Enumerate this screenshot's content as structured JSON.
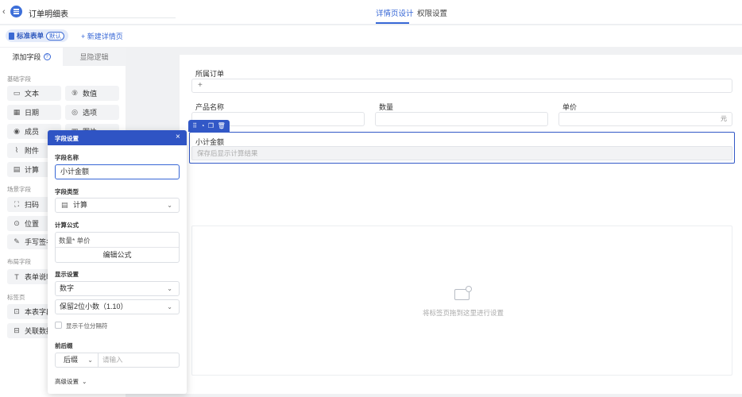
{
  "header": {
    "back_icon": "chevron-left-icon",
    "app_icon": "grid-app-icon",
    "title": "订单明细表",
    "tabs": [
      {
        "label": "详情页设计",
        "active": true
      },
      {
        "label": "权限设置",
        "active": false
      }
    ],
    "accent_color": "#3767d6"
  },
  "subbar": {
    "chip_label": "标准表单",
    "chip_badge": "默认",
    "new_page_label": "+ 新建详情页"
  },
  "left_panel": {
    "tabs": [
      {
        "label": "添加字段",
        "active": true
      },
      {
        "label": "显隐逻辑",
        "active": false
      }
    ],
    "sections": {
      "basic": "基础字段",
      "scene": "场景字段",
      "layout": "布局字段",
      "tab": "标签页"
    },
    "fields": {
      "text": {
        "label": "文本",
        "icon": "text-field-icon"
      },
      "number": {
        "label": "数值",
        "icon": "number-icon"
      },
      "date": {
        "label": "日期",
        "icon": "calendar-icon"
      },
      "option": {
        "label": "选项",
        "icon": "check-circle-icon"
      },
      "member": {
        "label": "成员",
        "icon": "member-icon"
      },
      "image": {
        "label": "图片",
        "icon": "image-icon"
      },
      "attachment": {
        "label": "附件",
        "icon": "paperclip-icon"
      },
      "calc": {
        "label": "计算",
        "icon": "calculator-icon"
      },
      "scan": {
        "label": "扫码",
        "icon": "scan-icon"
      },
      "location": {
        "label": "位置",
        "icon": "location-icon"
      },
      "signature": {
        "label": "手写签名",
        "icon": "signature-icon"
      },
      "form_desc": {
        "label": "表单说明",
        "icon": "text-t-icon"
      },
      "this_table": {
        "label": "本表字段",
        "icon": "table-icon"
      },
      "related": {
        "label": "关联数据",
        "icon": "link-data-icon"
      }
    }
  },
  "canvas": {
    "fields": {
      "order": {
        "label": "所属订单",
        "value": "+"
      },
      "product": {
        "label": "产品名称",
        "value": ""
      },
      "quantity": {
        "label": "数量",
        "value": ""
      },
      "price": {
        "label": "单价",
        "unit": "元"
      },
      "subtotal": {
        "label": "小计金额",
        "placeholder": "保存后显示计算结果"
      }
    },
    "toolbar_icons": [
      "drag-handle-icon",
      "copy-style-icon",
      "duplicate-icon",
      "delete-icon"
    ],
    "drop_zone_text": "将标签页拖到这里进行设置",
    "drop_zone_icon": "folder-add-icon"
  },
  "modal": {
    "title": "字段设置",
    "field_name_label": "字段名称",
    "field_name_value": "小计金额",
    "field_type_label": "字段类型",
    "field_type_value": "计算",
    "formula_label": "计算公式",
    "formula_value": "数量* 单价",
    "formula_button": "编辑公式",
    "display_label": "显示设置",
    "display_format": "数字",
    "decimal_setting": "保留2位小数（1.10）",
    "thousands_label": "显示千位分隔符",
    "thousands_checked": false,
    "affix_label": "前后缀",
    "affix_select": "后缀",
    "affix_placeholder": "请输入",
    "advanced_label": "高级设置"
  }
}
